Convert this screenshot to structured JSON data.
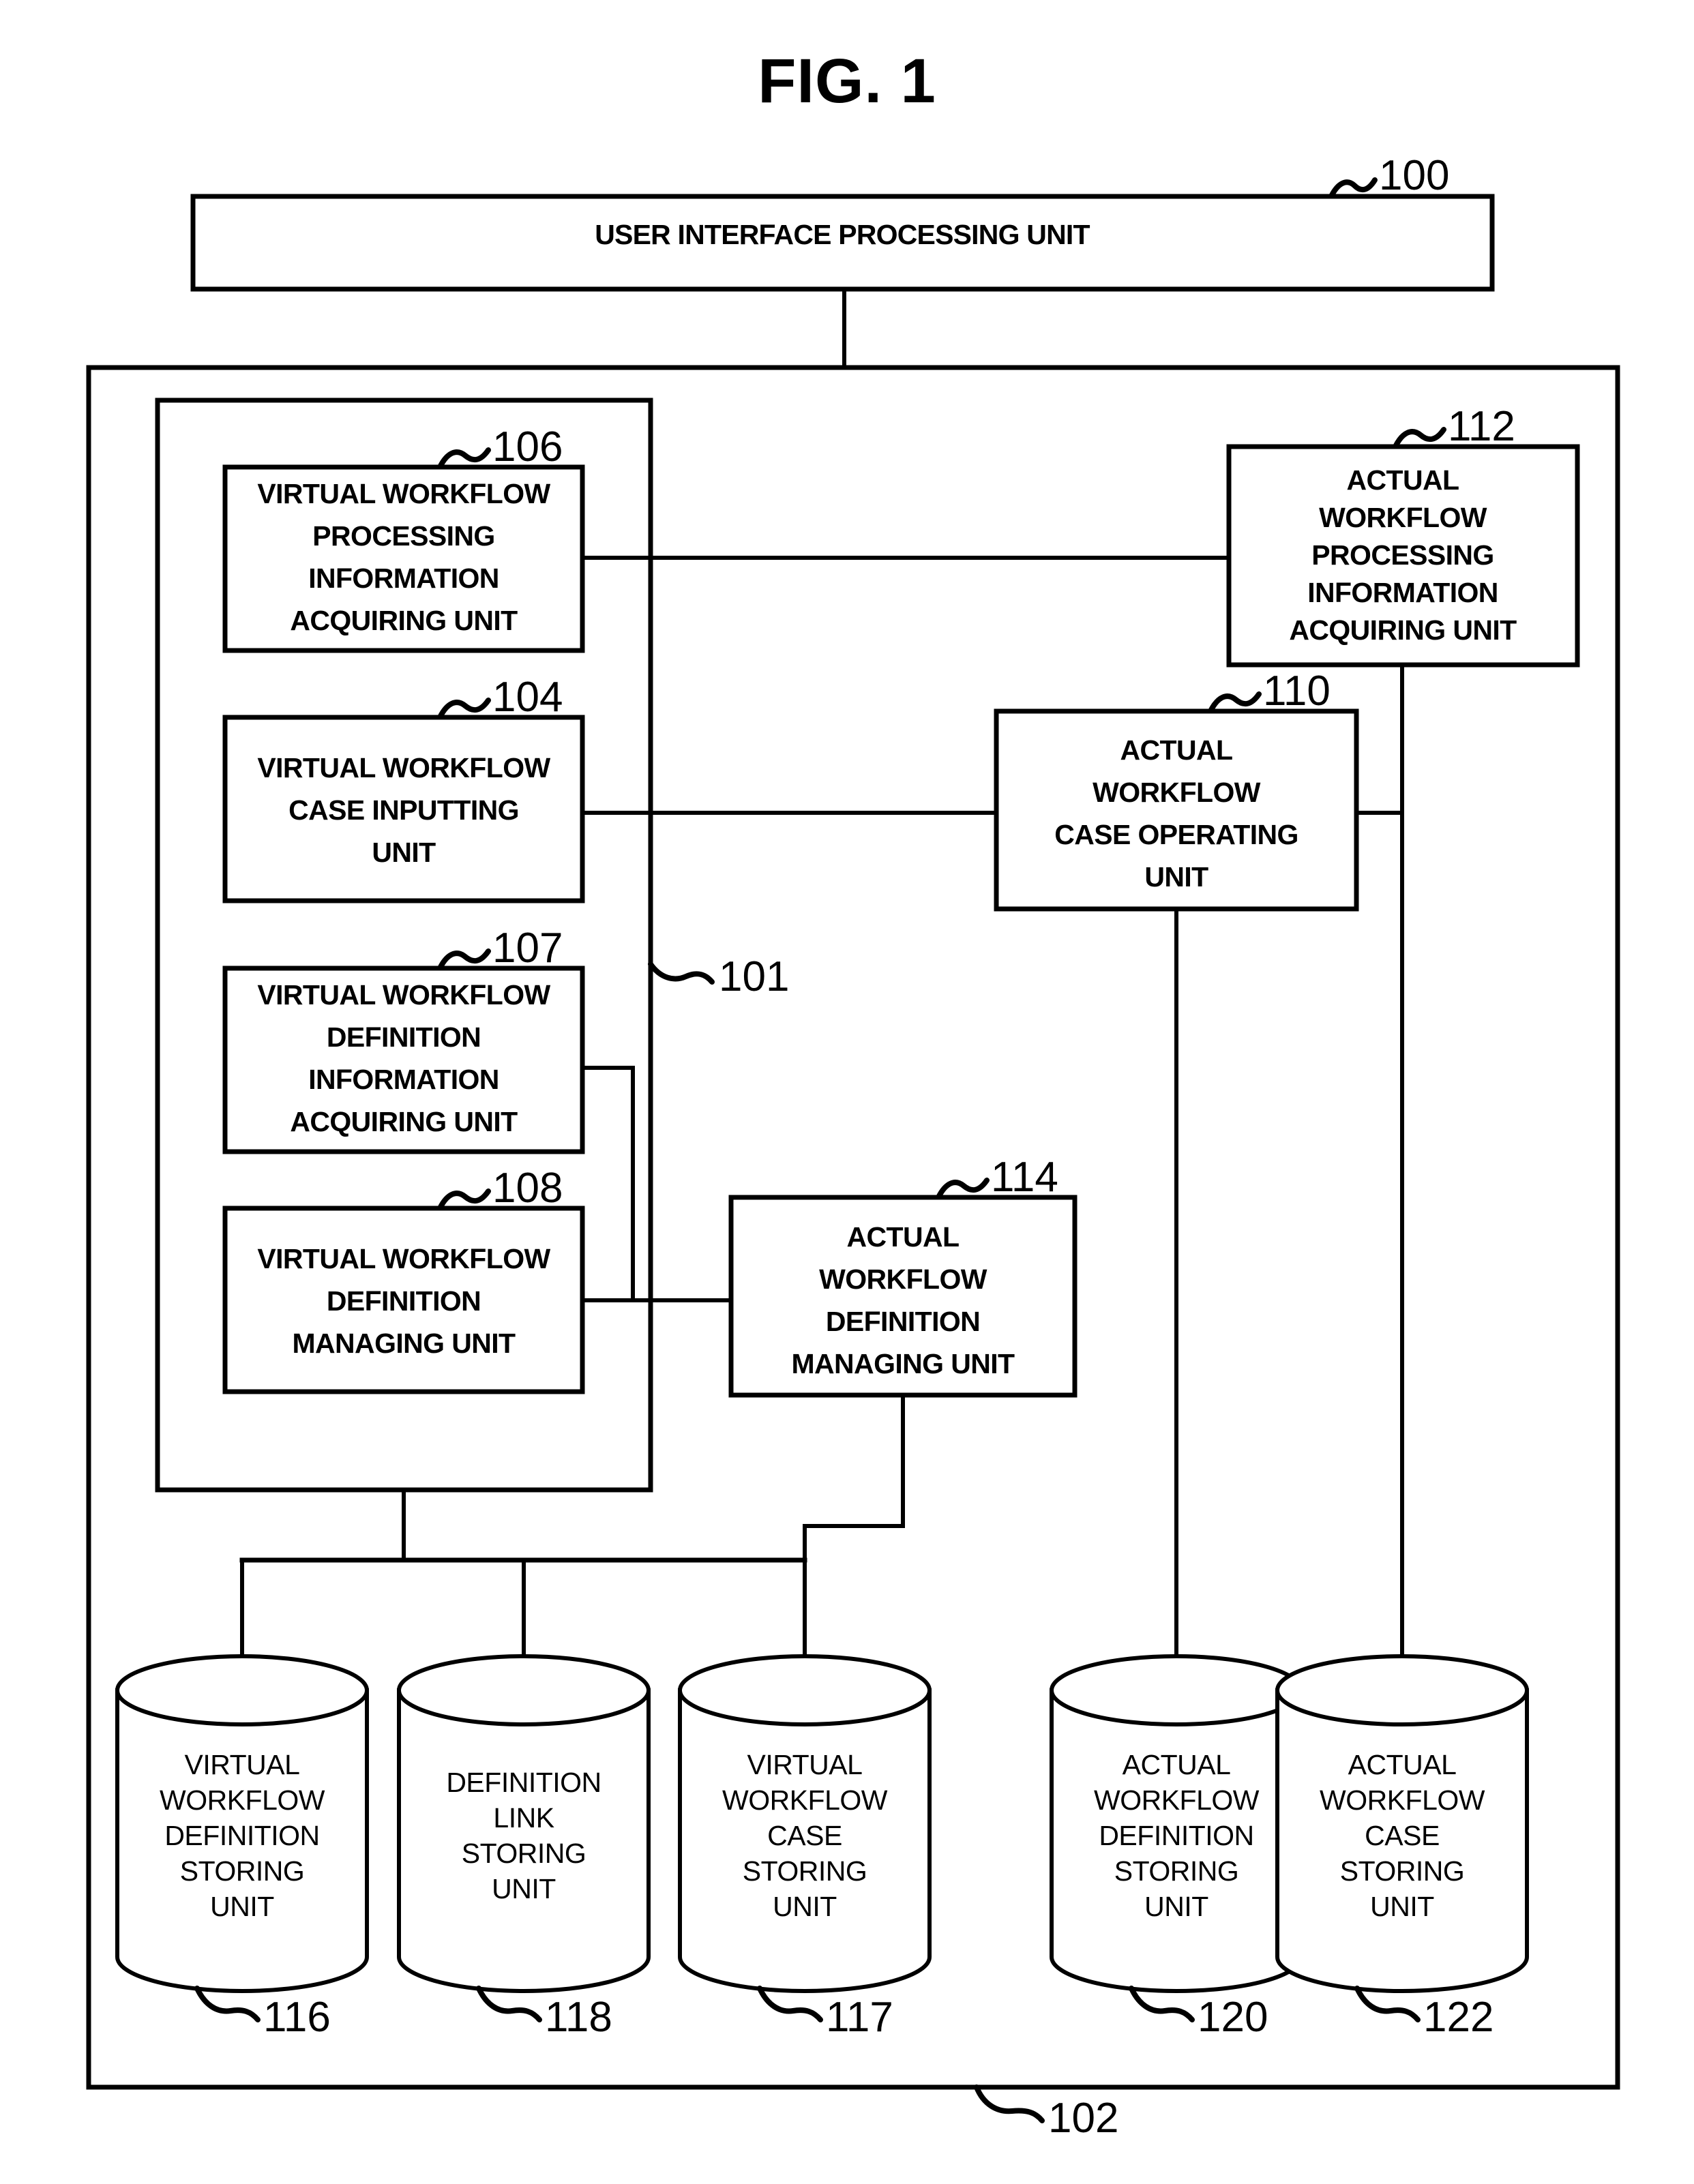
{
  "figure": {
    "title": "FIG. 1"
  },
  "top_unit": {
    "ref": "100",
    "label": "USER INTERFACE PROCESSING UNIT"
  },
  "outer_system": {
    "ref": "102"
  },
  "inner_group": {
    "ref": "101"
  },
  "units": [
    {
      "ref": "106",
      "lines": [
        "VIRTUAL WORKFLOW",
        "PROCESSING",
        "INFORMATION",
        "ACQUIRING UNIT"
      ],
      "name": "virtual-workflow-processing-information-acquiring-unit"
    },
    {
      "ref": "104",
      "lines": [
        "VIRTUAL WORKFLOW",
        "CASE INPUTTING",
        "UNIT"
      ],
      "name": "virtual-workflow-case-inputting-unit"
    },
    {
      "ref": "107",
      "lines": [
        "VIRTUAL WORKFLOW",
        "DEFINITION",
        "INFORMATION",
        "ACQUIRING UNIT"
      ],
      "name": "virtual-workflow-definition-information-acquiring-unit"
    },
    {
      "ref": "108",
      "lines": [
        "VIRTUAL WORKFLOW",
        "DEFINITION",
        "MANAGING UNIT"
      ],
      "name": "virtual-workflow-definition-managing-unit"
    },
    {
      "ref": "112",
      "lines": [
        "ACTUAL",
        "WORKFLOW",
        "PROCESSING",
        "INFORMATION",
        "ACQUIRING UNIT"
      ],
      "name": "actual-workflow-processing-information-acquiring-unit"
    },
    {
      "ref": "110",
      "lines": [
        "ACTUAL",
        "WORKFLOW",
        "CASE OPERATING",
        "UNIT"
      ],
      "name": "actual-workflow-case-operating-unit"
    },
    {
      "ref": "114",
      "lines": [
        "ACTUAL",
        "WORKFLOW",
        "DEFINITION",
        "MANAGING UNIT"
      ],
      "name": "actual-workflow-definition-managing-unit"
    }
  ],
  "stores": [
    {
      "ref": "116",
      "lines": [
        "VIRTUAL",
        "WORKFLOW",
        "DEFINITION",
        "STORING",
        "UNIT"
      ],
      "name": "virtual-workflow-definition-storing-unit"
    },
    {
      "ref": "118",
      "lines": [
        "DEFINITION",
        "LINK",
        "STORING",
        "UNIT"
      ],
      "name": "definition-link-storing-unit"
    },
    {
      "ref": "117",
      "lines": [
        "VIRTUAL",
        "WORKFLOW",
        "CASE",
        "STORING",
        "UNIT"
      ],
      "name": "virtual-workflow-case-storing-unit"
    },
    {
      "ref": "120",
      "lines": [
        "ACTUAL",
        "WORKFLOW",
        "DEFINITION",
        "STORING",
        "UNIT"
      ],
      "name": "actual-workflow-definition-storing-unit"
    },
    {
      "ref": "122",
      "lines": [
        "ACTUAL",
        "WORKFLOW",
        "CASE",
        "STORING",
        "UNIT"
      ],
      "name": "actual-workflow-case-storing-unit"
    }
  ],
  "colors": {
    "ink": "#000000",
    "paper": "#ffffff"
  }
}
